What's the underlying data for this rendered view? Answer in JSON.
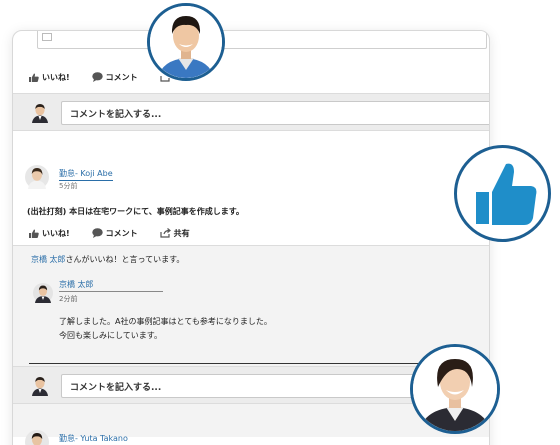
{
  "ui": {
    "like_label": "いいね!",
    "comment_label": "コメント",
    "share_label": "共有",
    "comment_placeholder": "コメントを記入する..."
  },
  "post1": {
    "author": "勤怠- Koji Abe",
    "time": "5分前",
    "body": "(出社打刻) 本日は在宅ワークにて、事例記事を作成します。"
  },
  "likes": {
    "liker": "京橋 太郎",
    "suffix": "さんがいいね！と言っています。"
  },
  "reply": {
    "author": "京橋 太郎",
    "time": "2分前",
    "line1": "了解しました。A社の事例記事はとても参考になりました。",
    "line2": "今回も楽しみにしています。"
  },
  "post2": {
    "author": "勤怠- Yuta Takano"
  },
  "colors": {
    "accent": "#1d5f92",
    "link": "#2a6ea8",
    "thumb": "#1f8ec9"
  },
  "icons": [
    "thumbs-up-icon",
    "speech-bubble-icon",
    "share-icon",
    "large-thumbs-up-icon"
  ]
}
